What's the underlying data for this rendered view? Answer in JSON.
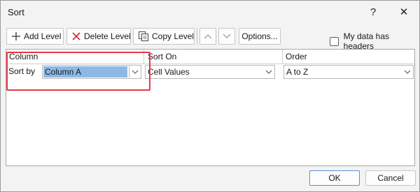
{
  "window": {
    "title": "Sort",
    "help": "?",
    "close": "✕"
  },
  "toolbar": {
    "add_level": "Add Level",
    "delete_level": "Delete Level",
    "copy_level": "Copy Level",
    "options": "Options...",
    "headers_label": "My data has headers",
    "headers_checked": false
  },
  "grid": {
    "headers": {
      "column": "Column",
      "sort_on": "Sort On",
      "order": "Order"
    },
    "rows": [
      {
        "label": "Sort by",
        "column": "Column A",
        "sort_on": "Cell Values",
        "order": "A to Z"
      }
    ]
  },
  "footer": {
    "ok": "OK",
    "cancel": "Cancel"
  },
  "colors": {
    "selection": "#8cb9e6",
    "highlight": "#e63946",
    "ok_border": "#5b8ed6"
  }
}
